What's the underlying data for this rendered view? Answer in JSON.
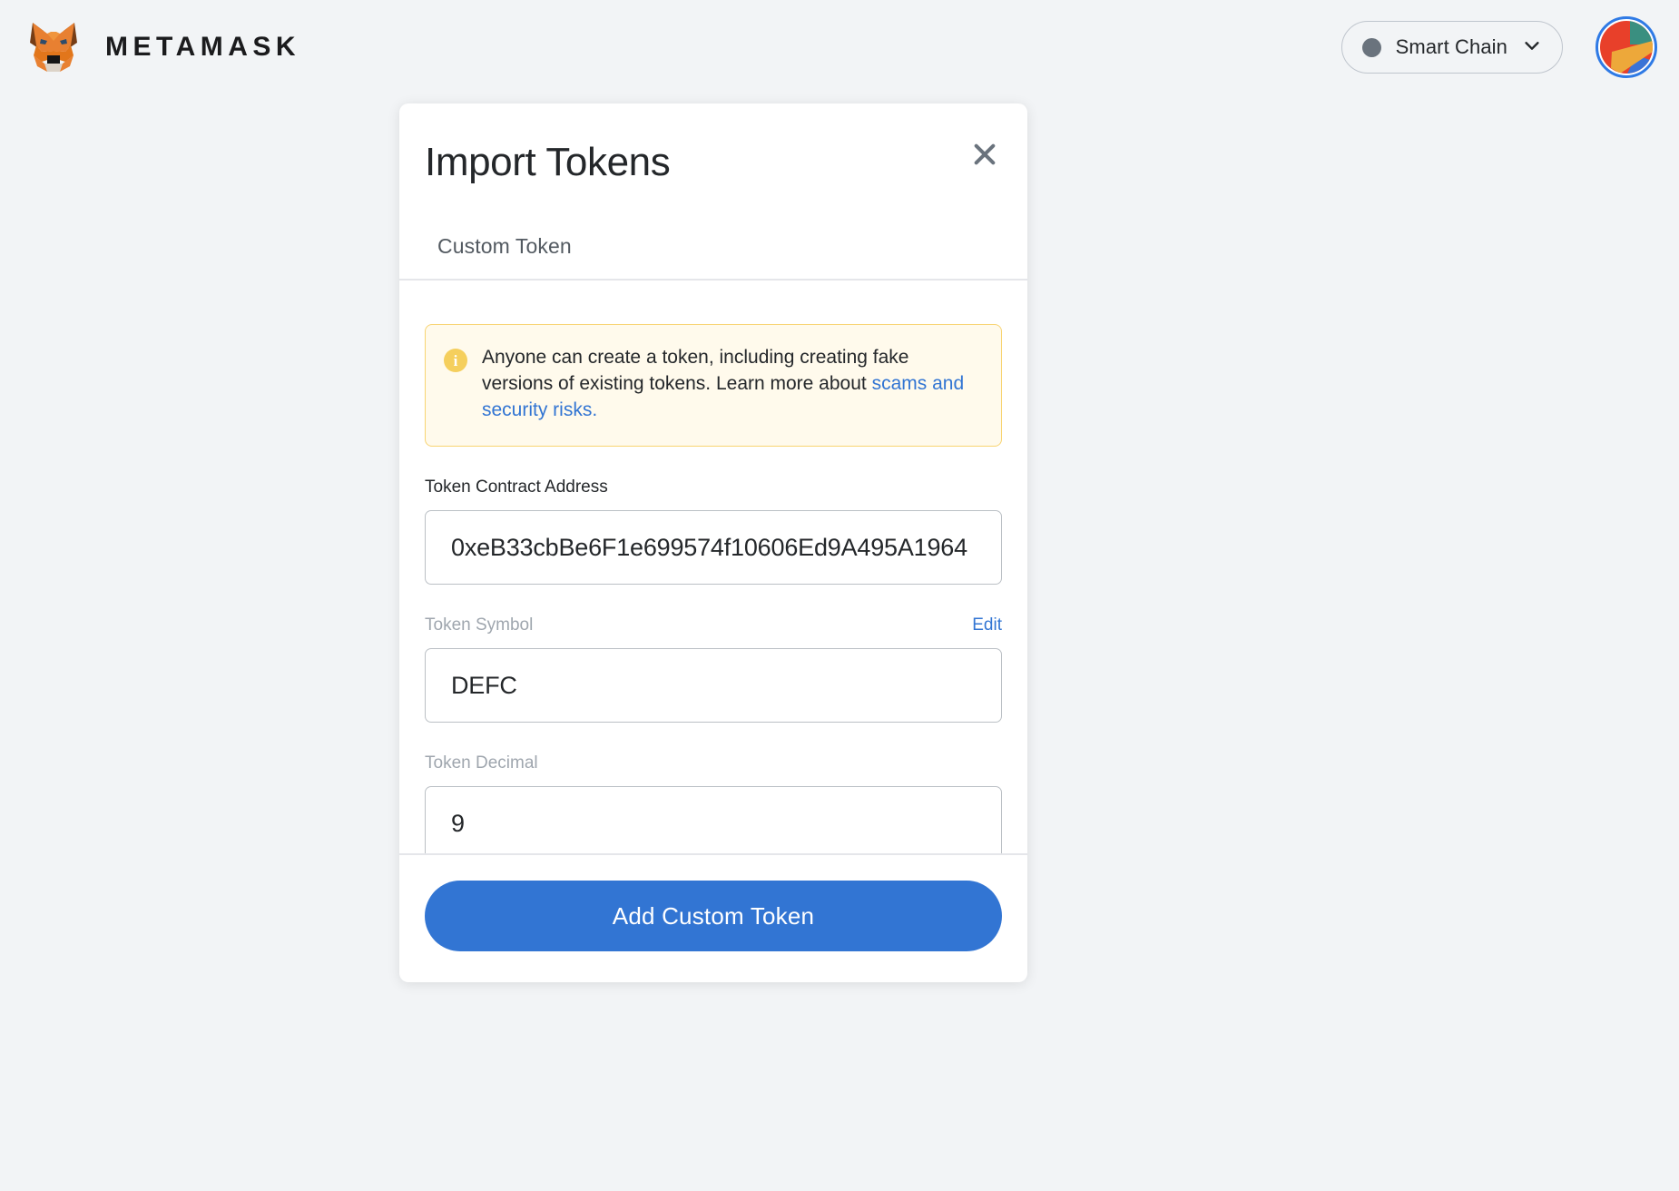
{
  "app": {
    "brand_name": "METAMASK",
    "logo_icon": "metamask-fox-logo"
  },
  "header": {
    "network": {
      "name": "Smart Chain",
      "status_dot_color": "#6a737d",
      "chevron_icon": "chevron-down-icon"
    },
    "account_avatar_icon": "account-jazzicon-avatar"
  },
  "modal": {
    "title": "Import Tokens",
    "close_icon": "close-icon",
    "tabs": [
      {
        "label": "Custom Token",
        "active": true
      }
    ],
    "notice": {
      "icon": "info-icon",
      "icon_glyph": "i",
      "text_before": "Anyone can create a token, including creating fake versions of existing tokens. Learn more about ",
      "link_text": "scams and security risks.",
      "background_color": "#fffaec",
      "border_color": "#f8d472",
      "icon_color": "#f5cf5d",
      "link_color": "#3275d3"
    },
    "fields": [
      {
        "label": "Token Contract Address",
        "label_muted": false,
        "value": "0xeB33cbBe6F1e699574f10606Ed9A495A1964",
        "placeholder": "0x...",
        "action_label": ""
      },
      {
        "label": "Token Symbol",
        "label_muted": true,
        "value": "DEFC",
        "placeholder": "",
        "action_label": "Edit"
      },
      {
        "label": "Token Decimal",
        "label_muted": true,
        "value": "9",
        "placeholder": "",
        "action_label": ""
      }
    ],
    "footer": {
      "primary_button_label": "Add Custom Token",
      "primary_button_color": "#3275d3"
    }
  },
  "theme": {
    "page_background": "#f2f4f6",
    "card_background": "#ffffff",
    "text_primary": "#24272a",
    "text_muted": "#9fa6ae",
    "accent_blue": "#3275d3",
    "border_light": "#e5e6ea",
    "input_border": "#bbc0c5"
  }
}
